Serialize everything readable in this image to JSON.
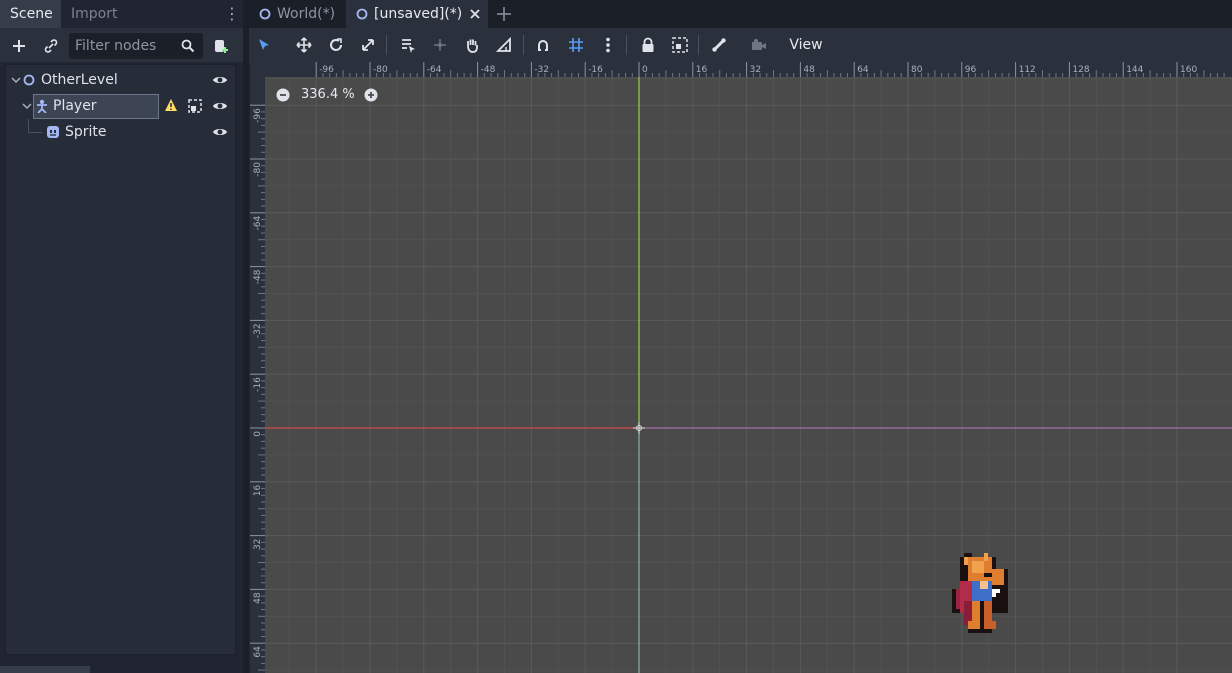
{
  "dock": {
    "tabs": [
      {
        "label": "Scene"
      },
      {
        "label": "Import"
      }
    ],
    "filter_placeholder": "Filter nodes",
    "tree": [
      {
        "label": "OtherLevel",
        "icon": "node2d-circle-icon"
      },
      {
        "label": "Player",
        "icon": "kinematic-body-icon",
        "warning": true
      },
      {
        "label": "Sprite",
        "icon": "sprite-icon"
      }
    ]
  },
  "editor": {
    "tabs": [
      {
        "label": "World(*)"
      },
      {
        "label": "[unsaved](*)"
      }
    ],
    "view_menu": "View",
    "zoom": "336.4 %"
  },
  "rulers": {
    "x_ticks": [
      "-96",
      "-80",
      "-64",
      "-48",
      "-32",
      "-16",
      "0",
      "16",
      "32",
      "48",
      "64",
      "80",
      "96",
      "112",
      "128",
      "144",
      "160"
    ],
    "y_ticks": [
      "-96",
      "-80",
      "-64",
      "-48",
      "-32",
      "-16",
      "0",
      "16",
      "32",
      "48",
      "64"
    ]
  },
  "colors": {
    "accent": "#5b9bf5",
    "x_axis": "#d24b4b",
    "y_axis": "#9ad04b",
    "warning": "#ffdd65"
  }
}
